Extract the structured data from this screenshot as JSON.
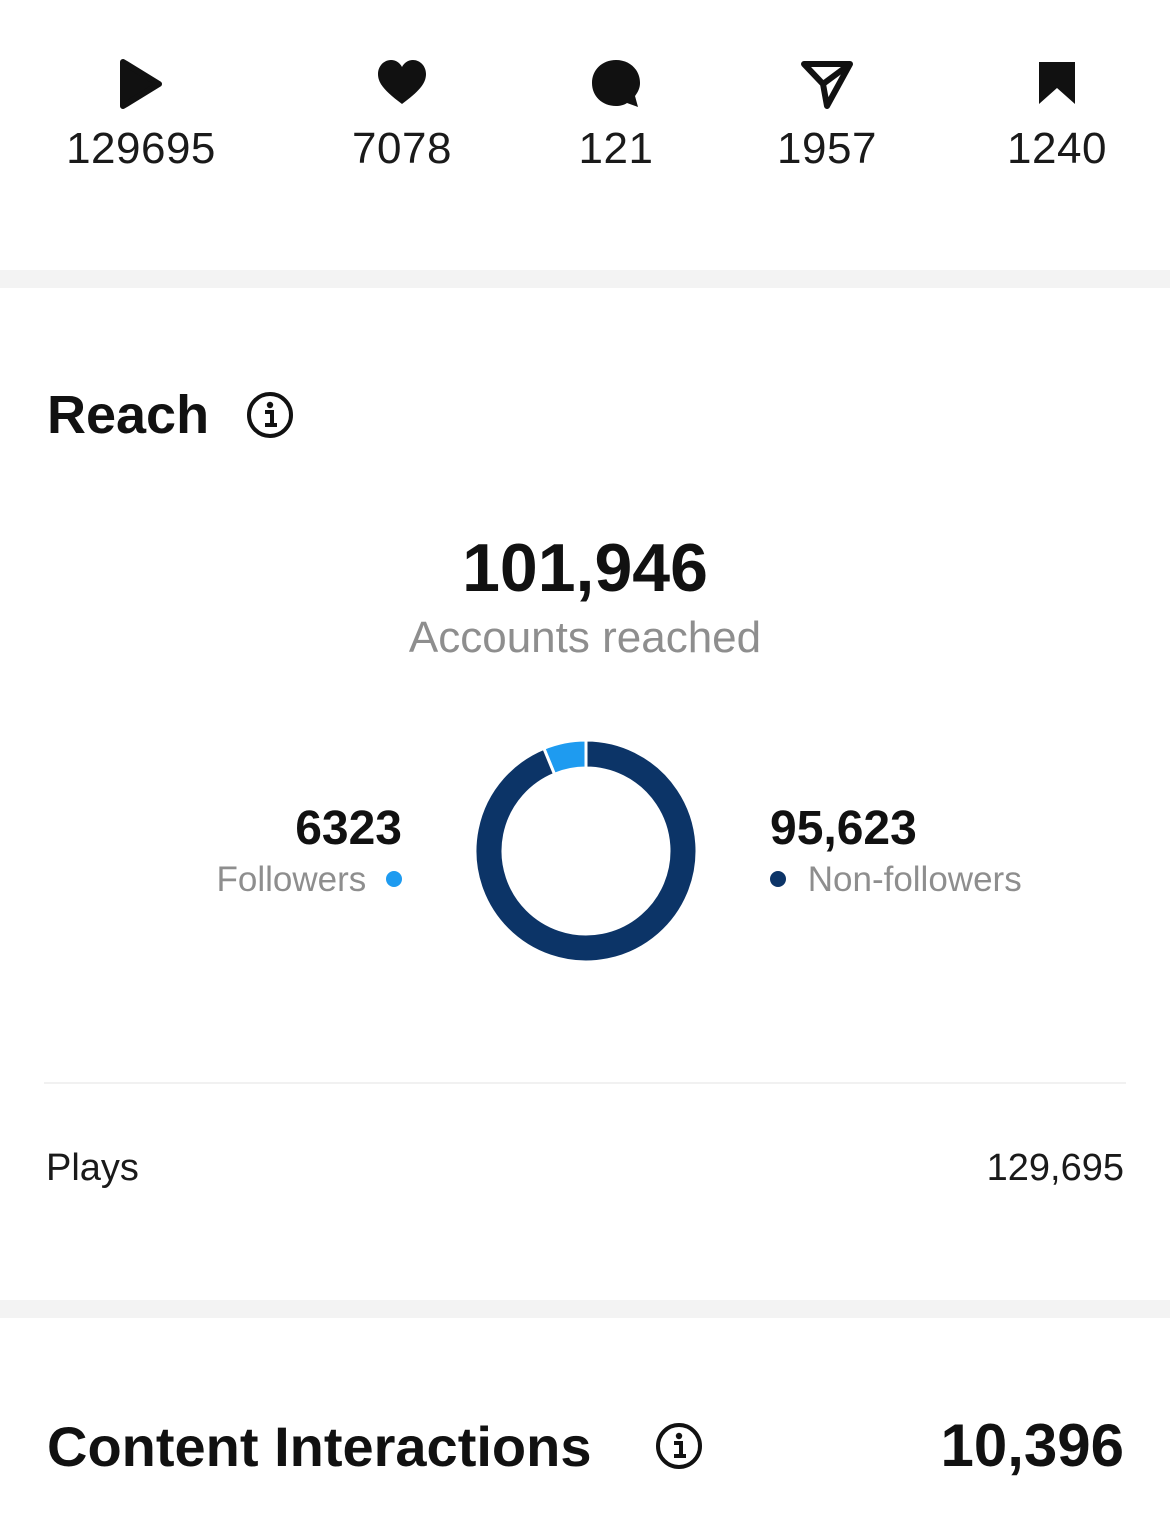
{
  "stats": [
    {
      "icon": "play-icon",
      "value": "129695"
    },
    {
      "icon": "heart-icon",
      "value": "7078"
    },
    {
      "icon": "comment-icon",
      "value": "121"
    },
    {
      "icon": "share-icon",
      "value": "1957"
    },
    {
      "icon": "bookmark-icon",
      "value": "1240"
    }
  ],
  "reach": {
    "title": "Reach",
    "total": "101,946",
    "caption": "Accounts reached",
    "followers": {
      "value": "6323",
      "label": "Followers",
      "color": "#1e9bf0"
    },
    "non_followers": {
      "value": "95,623",
      "label": "Non-followers",
      "color": "#0c3467"
    },
    "plays_label": "Plays",
    "plays_value": "129,695"
  },
  "content_interactions": {
    "title": "Content Interactions",
    "value": "10,396"
  },
  "chart_data": {
    "type": "pie",
    "categories": [
      "Followers",
      "Non-followers"
    ],
    "values": [
      6323,
      95623
    ],
    "colors": [
      "#1e9bf0",
      "#0c3467"
    ],
    "title": ""
  }
}
